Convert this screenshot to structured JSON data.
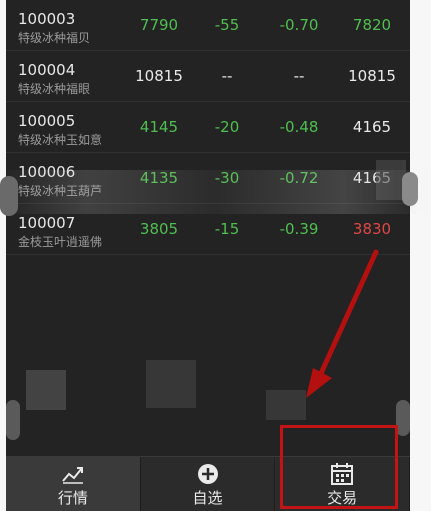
{
  "rows": [
    {
      "code": "100003",
      "name": "特级冰种福贝",
      "price": "7790",
      "change": "-55",
      "pct": "-0.70",
      "ref": "7820",
      "price_color": "green",
      "ref_color": "green"
    },
    {
      "code": "100004",
      "name": "特级冰种福眼",
      "price": "10815",
      "change": "--",
      "pct": "--",
      "ref": "10815",
      "price_color": "white",
      "ref_color": "white"
    },
    {
      "code": "100005",
      "name": "特级冰种玉如意",
      "price": "4145",
      "change": "-20",
      "pct": "-0.48",
      "ref": "4165",
      "price_color": "green",
      "ref_color": "white"
    },
    {
      "code": "100006",
      "name": "特级冰种玉葫芦",
      "price": "4135",
      "change": "-30",
      "pct": "-0.72",
      "ref": "4165",
      "price_color": "green",
      "ref_color": "white"
    },
    {
      "code": "100007",
      "name": "金枝玉叶逍遥佛",
      "price": "3805",
      "change": "-15",
      "pct": "-0.39",
      "ref": "3830",
      "price_color": "green",
      "ref_color": "red"
    }
  ],
  "tabs": [
    {
      "label": "行情",
      "icon": "chart-line-icon",
      "active": true
    },
    {
      "label": "自选",
      "icon": "add-circle-icon",
      "active": false
    },
    {
      "label": "交易",
      "icon": "calendar-icon",
      "active": false
    }
  ],
  "colors": {
    "up": "#e04747",
    "down": "#4fbf4f",
    "annotation": "#c21414"
  }
}
